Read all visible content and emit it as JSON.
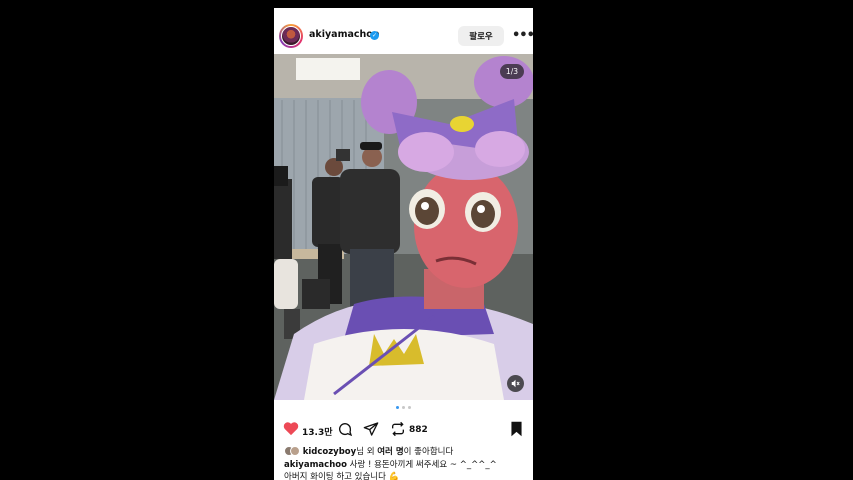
{
  "post": {
    "username": "akiyamachoo",
    "follow_label": "팔로우",
    "more_label": "•••",
    "counter": "1/3"
  },
  "actions": {
    "like_count": "13.3만",
    "repost_count": "882"
  },
  "likes": {
    "user": "kidcozyboy",
    "suffix_1": "님 외 ",
    "others": "여러 명",
    "suffix_2": "이 좋아합니다"
  },
  "caption": {
    "user": "akiyamachoo",
    "text": " 사랑 ! 용돈아끼게 써주세요 ~ ^_^^_^",
    "line2": "아버지 화이팅 하고 있습니다 💪"
  },
  "colors": {
    "like": "#ed4956",
    "verified": "#1d9bf0",
    "dot_active": "#3897f0"
  }
}
